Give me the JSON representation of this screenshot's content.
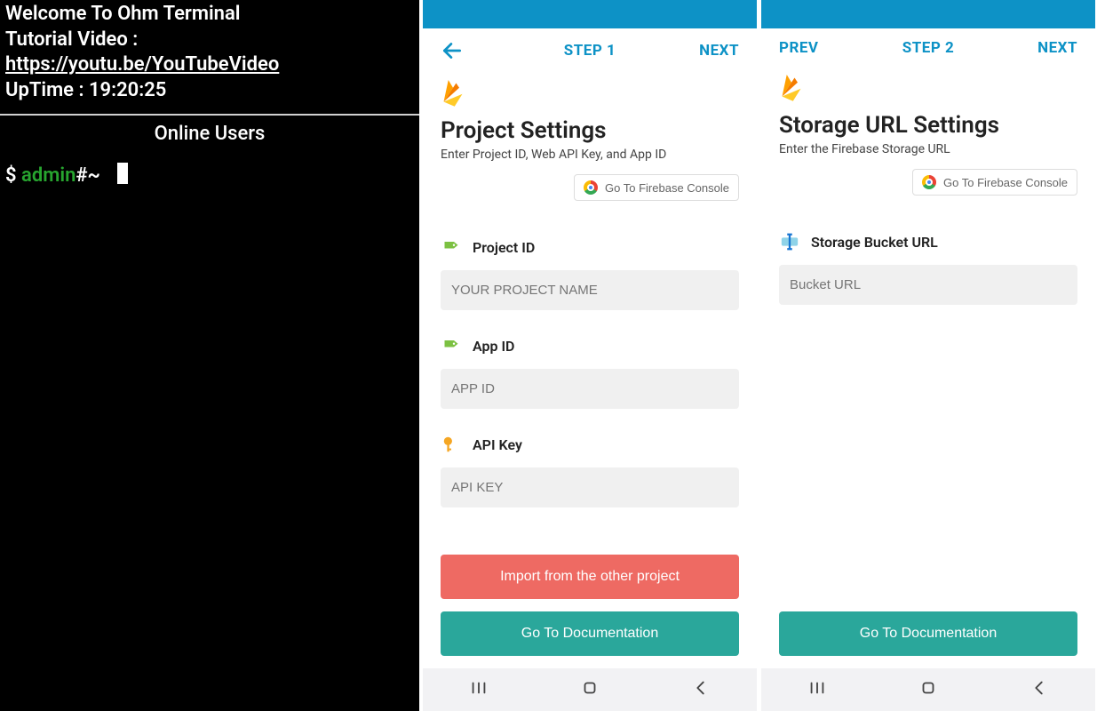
{
  "terminal": {
    "welcome": "Welcome To Ohm Terminal",
    "tutorial_label": "Tutorial Video :",
    "tutorial_link": "https://youtu.be/YouTubeVideo",
    "uptime": "UpTime : 19:20:25",
    "section": "Online Users",
    "prompt_dollar": "$",
    "prompt_user": "admin",
    "prompt_hash": "#~"
  },
  "step1": {
    "nav": {
      "back": "←",
      "center": "STEP 1",
      "right": "NEXT"
    },
    "title": "Project Settings",
    "subtitle": "Enter Project ID, Web API Key, and App ID",
    "console_btn": "Go To Firebase Console",
    "fields": {
      "project_id_label": "Project ID",
      "project_id_ph": "YOUR PROJECT NAME",
      "app_id_label": "App ID",
      "app_id_ph": "APP ID",
      "api_key_label": "API Key",
      "api_key_ph": "API KEY"
    },
    "import_btn": "Import from the other project",
    "docs_btn": "Go To Documentation"
  },
  "step2": {
    "nav": {
      "left": "PREV",
      "center": "STEP 2",
      "right": "NEXT"
    },
    "title": "Storage URL Settings",
    "subtitle": "Enter the Firebase Storage URL",
    "console_btn": "Go To Firebase Console",
    "fields": {
      "bucket_label": "Storage Bucket URL",
      "bucket_ph": "Bucket URL"
    },
    "docs_btn": "Go To Documentation"
  },
  "colors": {
    "accent_blue": "#0d92c6",
    "teal": "#2aa79b",
    "red": "#ee6a63",
    "term_green": "#27a52f"
  }
}
